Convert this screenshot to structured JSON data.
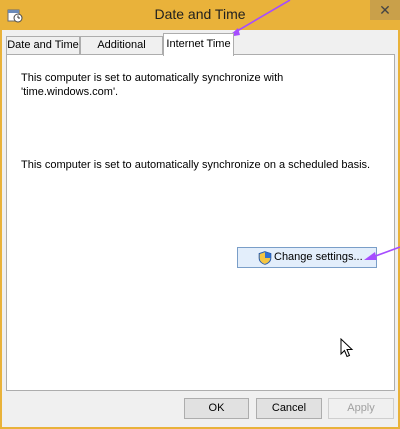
{
  "window": {
    "title": "Date and Time",
    "close_glyph": "✕"
  },
  "tabs": [
    {
      "label": "Date and Time"
    },
    {
      "label": "Additional Clocks"
    },
    {
      "label": "Internet Time"
    }
  ],
  "panel": {
    "status_text": "This computer is set to automatically synchronize with 'time.windows.com'.",
    "schedule_text": "This computer is set to automatically synchronize on a scheduled basis.",
    "change_settings_label": "Change settings..."
  },
  "footer": {
    "ok_label": "OK",
    "cancel_label": "Cancel",
    "apply_label": "Apply"
  },
  "icons": {
    "app": "date-time-icon",
    "shield": "uac-shield-icon",
    "cursor": "mouse-pointer-icon"
  },
  "colors": {
    "titlebar": "#e9b23a",
    "annotation_arrow": "#a64dff"
  }
}
